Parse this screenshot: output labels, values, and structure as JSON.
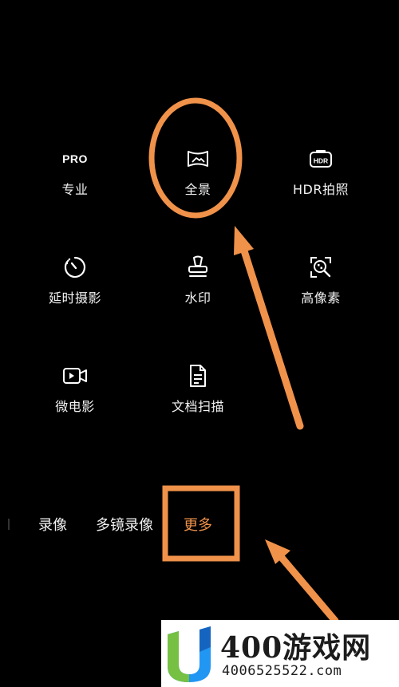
{
  "modes_grid": [
    {
      "label": "专业",
      "icon": "pro-icon",
      "icon_text": "PRO"
    },
    {
      "label": "全景",
      "icon": "panorama-icon"
    },
    {
      "label": "HDR拍照",
      "icon": "hdr-icon",
      "icon_text": "HDR"
    },
    {
      "label": "延时摄影",
      "icon": "timelapse-icon"
    },
    {
      "label": "水印",
      "icon": "watermark-stamp-icon"
    },
    {
      "label": "高像素",
      "icon": "high-pixel-icon"
    },
    {
      "label": "微电影",
      "icon": "micro-movie-icon"
    },
    {
      "label": "文档扫描",
      "icon": "document-scan-icon"
    }
  ],
  "mode_bar": {
    "items": [
      "录像",
      "多镜录像",
      "更多"
    ],
    "active": "更多"
  },
  "annotation_color": "#f0924a",
  "watermark": {
    "name": "400游戏网",
    "phone": "4006525522.com"
  }
}
